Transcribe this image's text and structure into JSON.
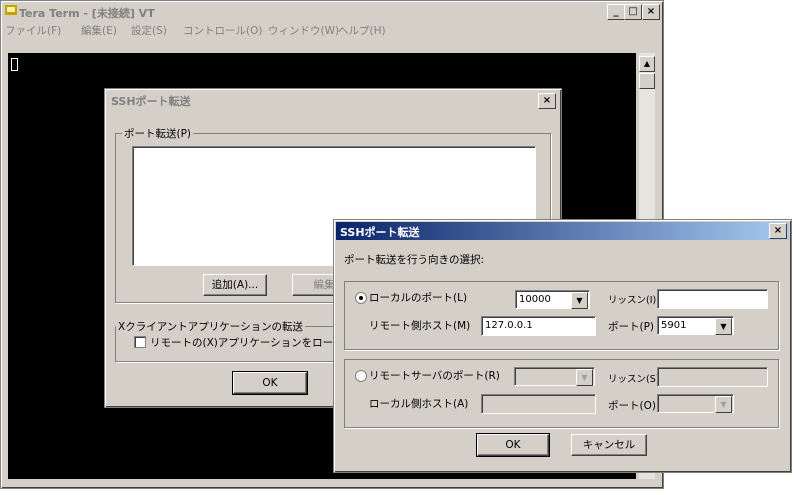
{
  "teraterm": {
    "title": "Tera Term - [未接続] VT",
    "menu": [
      "ファイル(F)",
      "編集(E)",
      "設定(S)",
      "コントロール(O)",
      "ウィンドウ(W)",
      "ヘルプ(H)"
    ],
    "buttons": {
      "minimize": "_",
      "maximize": "□",
      "close": "×"
    }
  },
  "ssh_dialog": {
    "title": "SSHポート転送",
    "close": "×",
    "port_forward_group": "ポート転送(P)",
    "add_button": "追加(A)...",
    "edit_button": "編集",
    "x11_group": "Xクライアントアプリケーションの転送",
    "x11_checkbox": "リモートの(X)アプリケーションをローカ",
    "ok_button": "OK"
  },
  "fwd_dialog": {
    "title": "SSHポート転送",
    "close": "×",
    "prompt": "ポート転送を行う向きの選択:",
    "local": {
      "radio_label": "ローカルのポート(L)",
      "port_value": "10000",
      "listen_label": "リッスン(I)",
      "listen_value": "",
      "remote_host_label": "リモート側ホスト(M)",
      "remote_host_value": "127.0.0.1",
      "port_label": "ポート(P)",
      "port_value2": "5901"
    },
    "remote": {
      "radio_label": "リモートサーバのポート(R)",
      "port_value": "",
      "listen_label": "リッスン(S)",
      "listen_value": "",
      "local_host_label": "ローカル側ホスト(A)",
      "local_host_value": "",
      "port_label": "ポート(O)",
      "port_value2": ""
    },
    "ok_button": "OK",
    "cancel_button": "キャンセル"
  }
}
